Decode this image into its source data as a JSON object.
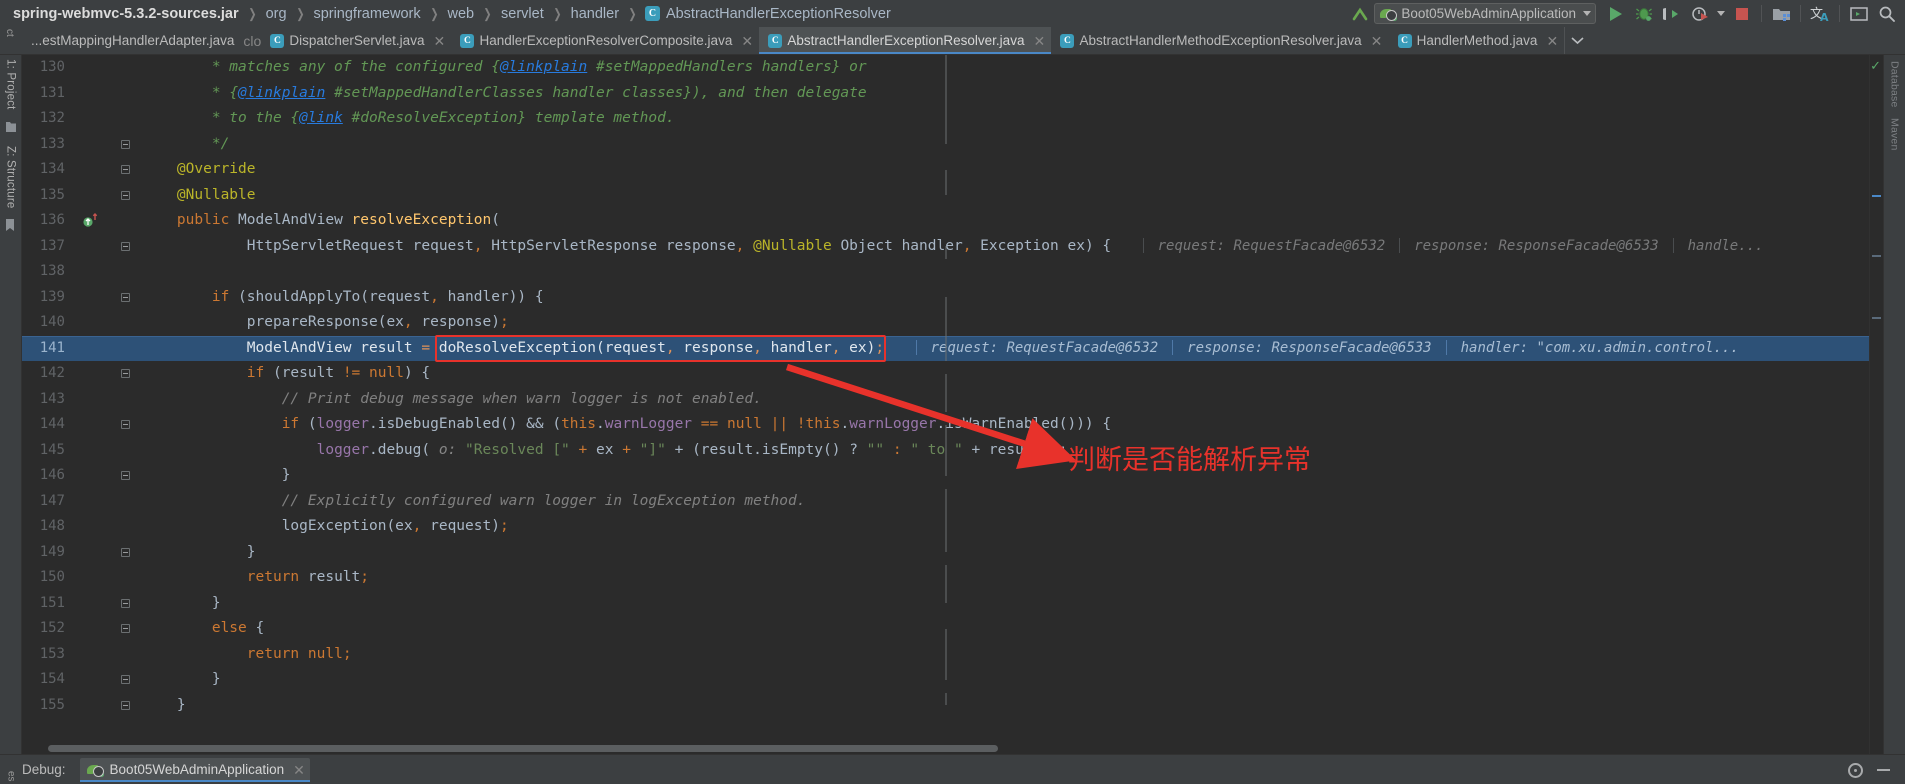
{
  "window": {
    "breadcrumb": {
      "root": "spring-webmvc-5.3.2-sources.jar",
      "items": [
        "org",
        "springframework",
        "web",
        "servlet",
        "handler"
      ],
      "class_badge": "C",
      "current_class": "AbstractHandlerExceptionResolver"
    },
    "toolbar": {
      "run_config": "Boot05WebAdminApplication",
      "icons": [
        "arrow-up-icon",
        "run-icon",
        "debug-icon",
        "run-coverage-icon",
        "profiler-icon",
        "stop-icon",
        "project-structure-icon",
        "translate-icon",
        "terminal-icon",
        "search-icon"
      ],
      "window_buttons": [
        "minimize",
        "maximize",
        "close"
      ]
    }
  },
  "tabs": {
    "items": [
      {
        "label": "...estMappingHandlerAdapter.java",
        "icon": "java-class-icon",
        "active": false,
        "truncated": true
      },
      {
        "label": "DispatcherServlet.java",
        "icon": "java-class-icon",
        "active": false
      },
      {
        "label": "HandlerExceptionResolverComposite.java",
        "icon": "java-class-icon",
        "active": false
      },
      {
        "label": "AbstractHandlerExceptionResolver.java",
        "icon": "java-class-icon",
        "active": true
      },
      {
        "label": "AbstractHandlerMethodExceptionResolver.java",
        "icon": "java-class-icon",
        "active": false
      },
      {
        "label": "HandlerMethod.java",
        "icon": "java-class-icon",
        "active": false
      }
    ],
    "overflow_icon": "chevron-down-icon",
    "close_icon": "close-icon"
  },
  "left_strip": {
    "items": [
      {
        "label": "1: Project",
        "name": "tool-window-project"
      },
      {
        "label": "Z: Structure",
        "name": "tool-window-structure"
      }
    ]
  },
  "right_strip": {
    "items": [
      {
        "label": "Database",
        "name": "tool-window-database"
      },
      {
        "label": "Maven",
        "name": "tool-window-maven"
      }
    ]
  },
  "editor": {
    "first_line": 130,
    "lines": [
      {
        "n": 130,
        "fold": "thru",
        "segments": [
          {
            "t": "        ",
            "c": "plain"
          },
          {
            "t": "* matches any of the configured ",
            "c": "cmt"
          },
          {
            "t": "{",
            "c": "cmt"
          },
          {
            "t": "@linkplain",
            "c": "doclink"
          },
          {
            "t": " #setMappedHandlers handlers} or",
            "c": "cmt"
          }
        ]
      },
      {
        "n": 131,
        "fold": "thru",
        "segments": [
          {
            "t": "        ",
            "c": "plain"
          },
          {
            "t": "* ",
            "c": "cmt"
          },
          {
            "t": "{",
            "c": "cmt"
          },
          {
            "t": "@linkplain",
            "c": "doclink"
          },
          {
            "t": " #setMappedHandlerClasses handler classes})",
            "c": "cmt"
          },
          {
            "t": ", and then delegate",
            "c": "cmt"
          }
        ]
      },
      {
        "n": 132,
        "fold": "thru",
        "segments": [
          {
            "t": "        ",
            "c": "plain"
          },
          {
            "t": "* to the ",
            "c": "cmt"
          },
          {
            "t": "{",
            "c": "cmt"
          },
          {
            "t": "@link",
            "c": "doclink"
          },
          {
            "t": " #doResolveException} template method.",
            "c": "cmt"
          }
        ]
      },
      {
        "n": 133,
        "fold": "end-up",
        "segments": [
          {
            "t": "        ",
            "c": "plain"
          },
          {
            "t": "*/",
            "c": "cmt"
          }
        ]
      },
      {
        "n": 134,
        "fold": "start",
        "segments": [
          {
            "t": "    ",
            "c": "plain"
          },
          {
            "t": "@Override",
            "c": "ann"
          }
        ]
      },
      {
        "n": 135,
        "fold": "end-up",
        "segments": [
          {
            "t": "    ",
            "c": "plain"
          },
          {
            "t": "@Nullable",
            "c": "ann"
          }
        ]
      },
      {
        "n": 136,
        "marker": "override-method-icon",
        "fold": "none",
        "segments": [
          {
            "t": "    ",
            "c": "plain"
          },
          {
            "t": "public",
            "c": "kw"
          },
          {
            "t": " ",
            "c": "plain"
          },
          {
            "t": "ModelAndView",
            "c": "typ"
          },
          {
            "t": " ",
            "c": "plain"
          },
          {
            "t": "resolveException",
            "c": "fn"
          },
          {
            "t": "(",
            "c": "punc"
          }
        ]
      },
      {
        "n": 137,
        "fold": "start",
        "segments": [
          {
            "t": "            ",
            "c": "plain"
          },
          {
            "t": "HttpServletRequest",
            "c": "typ"
          },
          {
            "t": " request",
            "c": "ident"
          },
          {
            "t": ",",
            "c": "semi"
          },
          {
            "t": " ",
            "c": "plain"
          },
          {
            "t": "HttpServletResponse",
            "c": "typ"
          },
          {
            "t": " response",
            "c": "ident"
          },
          {
            "t": ",",
            "c": "semi"
          },
          {
            "t": " ",
            "c": "plain"
          },
          {
            "t": "@Nullable",
            "c": "ann"
          },
          {
            "t": " ",
            "c": "plain"
          },
          {
            "t": "Object",
            "c": "typ"
          },
          {
            "t": " handler",
            "c": "ident"
          },
          {
            "t": ",",
            "c": "semi"
          },
          {
            "t": " ",
            "c": "plain"
          },
          {
            "t": "Exception",
            "c": "typ"
          },
          {
            "t": " ex",
            "c": "ident"
          },
          {
            "t": ")",
            "c": "punc"
          },
          {
            "t": " {",
            "c": "punc"
          }
        ],
        "debug": [
          "request: RequestFacade@6532",
          "response: ResponseFacade@6533",
          "handle..."
        ]
      },
      {
        "n": 138,
        "fold": "none",
        "segments": []
      },
      {
        "n": 139,
        "fold": "start",
        "segments": [
          {
            "t": "        ",
            "c": "plain"
          },
          {
            "t": "if",
            "c": "kw"
          },
          {
            "t": " (",
            "c": "punc"
          },
          {
            "t": "shouldApplyTo",
            "c": "ident"
          },
          {
            "t": "(request",
            "c": "ident"
          },
          {
            "t": ",",
            "c": "semi"
          },
          {
            "t": " handler",
            "c": "ident"
          },
          {
            "t": ")) {",
            "c": "punc"
          }
        ]
      },
      {
        "n": 140,
        "fold": "thru",
        "segments": [
          {
            "t": "            ",
            "c": "plain"
          },
          {
            "t": "prepareResponse",
            "c": "ident"
          },
          {
            "t": "(ex",
            "c": "ident"
          },
          {
            "t": ",",
            "c": "semi"
          },
          {
            "t": " response",
            "c": "ident"
          },
          {
            "t": ")",
            "c": "punc"
          },
          {
            "t": ";",
            "c": "semi"
          }
        ]
      },
      {
        "n": 141,
        "fold": "thru",
        "highlight": true,
        "boxed_call": "doResolveException(request, response, handler, ex);",
        "segments": [
          {
            "t": "            ",
            "c": "plain"
          },
          {
            "t": "ModelAndView",
            "c": "typ"
          },
          {
            "t": " result ",
            "c": "ident"
          },
          {
            "t": "=",
            "c": "semi"
          },
          {
            "t": " ",
            "c": "plain"
          },
          {
            "t": "doResolveException",
            "c": "ident"
          },
          {
            "t": "(request",
            "c": "ident"
          },
          {
            "t": ",",
            "c": "semi"
          },
          {
            "t": " response",
            "c": "ident"
          },
          {
            "t": ",",
            "c": "semi"
          },
          {
            "t": " handler",
            "c": "ident"
          },
          {
            "t": ",",
            "c": "semi"
          },
          {
            "t": " ex",
            "c": "ident"
          },
          {
            "t": ")",
            "c": "punc"
          },
          {
            "t": ";",
            "c": "semi"
          }
        ],
        "debug": [
          "request: RequestFacade@6532",
          "response: ResponseFacade@6533",
          "handler: \"com.xu.admin.control..."
        ]
      },
      {
        "n": 142,
        "fold": "start",
        "segments": [
          {
            "t": "            ",
            "c": "plain"
          },
          {
            "t": "if",
            "c": "kw"
          },
          {
            "t": " (result ",
            "c": "ident"
          },
          {
            "t": "!=",
            "c": "semi"
          },
          {
            "t": " ",
            "c": "plain"
          },
          {
            "t": "null",
            "c": "kw"
          },
          {
            "t": ") {",
            "c": "punc"
          }
        ]
      },
      {
        "n": 143,
        "fold": "thru",
        "segments": [
          {
            "t": "                ",
            "c": "plain"
          },
          {
            "t": "// Print debug message when warn logger is not enabled.",
            "c": "cmtln"
          }
        ]
      },
      {
        "n": 144,
        "fold": "start",
        "segments": [
          {
            "t": "                ",
            "c": "plain"
          },
          {
            "t": "if",
            "c": "kw"
          },
          {
            "t": " (",
            "c": "punc"
          },
          {
            "t": "logger",
            "c": "fld"
          },
          {
            "t": ".isDebugEnabled() && (",
            "c": "ident"
          },
          {
            "t": "this",
            "c": "kw"
          },
          {
            "t": ".",
            "c": "punc"
          },
          {
            "t": "warnLogger",
            "c": "fld"
          },
          {
            "t": " == ",
            "c": "semi"
          },
          {
            "t": "null",
            "c": "kw"
          },
          {
            "t": " || !",
            "c": "semi"
          },
          {
            "t": "this",
            "c": "kw"
          },
          {
            "t": ".",
            "c": "punc"
          },
          {
            "t": "warnLogger",
            "c": "fld"
          },
          {
            "t": ".isWarnEnabled())) {",
            "c": "ident"
          }
        ]
      },
      {
        "n": 145,
        "fold": "thru",
        "segments": [
          {
            "t": "                    ",
            "c": "plain"
          },
          {
            "t": "logger",
            "c": "fld"
          },
          {
            "t": ".debug(",
            "c": "ident"
          },
          {
            "t": " o: ",
            "c": "param-hint"
          },
          {
            "t": "\"Resolved [\"",
            "c": "str"
          },
          {
            "t": " + ",
            "c": "semi"
          },
          {
            "t": "ex",
            "c": "ident"
          },
          {
            "t": " + ",
            "c": "semi"
          },
          {
            "t": "\"]\"",
            "c": "str"
          },
          {
            "t": " + (result.isEmpty() ? ",
            "c": "ident"
          },
          {
            "t": "\"\"",
            "c": "str"
          },
          {
            "t": " : ",
            "c": "semi"
          },
          {
            "t": "\" to \"",
            "c": "str"
          },
          {
            "t": " + result));",
            "c": "ident"
          }
        ]
      },
      {
        "n": 146,
        "fold": "end-up",
        "segments": [
          {
            "t": "                ",
            "c": "plain"
          },
          {
            "t": "}",
            "c": "punc"
          }
        ]
      },
      {
        "n": 147,
        "fold": "thru",
        "segments": [
          {
            "t": "                ",
            "c": "plain"
          },
          {
            "t": "// Explicitly configured warn logger in logException method.",
            "c": "cmtln"
          }
        ]
      },
      {
        "n": 148,
        "fold": "thru",
        "segments": [
          {
            "t": "                ",
            "c": "plain"
          },
          {
            "t": "logException",
            "c": "ident"
          },
          {
            "t": "(ex",
            "c": "ident"
          },
          {
            "t": ",",
            "c": "semi"
          },
          {
            "t": " request",
            "c": "ident"
          },
          {
            "t": ")",
            "c": "punc"
          },
          {
            "t": ";",
            "c": "semi"
          }
        ]
      },
      {
        "n": 149,
        "fold": "end-up",
        "segments": [
          {
            "t": "            ",
            "c": "plain"
          },
          {
            "t": "}",
            "c": "punc"
          }
        ]
      },
      {
        "n": 150,
        "fold": "thru",
        "segments": [
          {
            "t": "            ",
            "c": "plain"
          },
          {
            "t": "return",
            "c": "kw"
          },
          {
            "t": " result",
            "c": "ident"
          },
          {
            "t": ";",
            "c": "semi"
          }
        ]
      },
      {
        "n": 151,
        "fold": "end-up",
        "segments": [
          {
            "t": "        ",
            "c": "plain"
          },
          {
            "t": "}",
            "c": "punc"
          }
        ]
      },
      {
        "n": 152,
        "fold": "start",
        "segments": [
          {
            "t": "        ",
            "c": "plain"
          },
          {
            "t": "else",
            "c": "kw"
          },
          {
            "t": " {",
            "c": "punc"
          }
        ]
      },
      {
        "n": 153,
        "fold": "thru",
        "segments": [
          {
            "t": "            ",
            "c": "plain"
          },
          {
            "t": "return",
            "c": "kw"
          },
          {
            "t": " ",
            "c": "plain"
          },
          {
            "t": "null",
            "c": "kw"
          },
          {
            "t": ";",
            "c": "semi"
          }
        ]
      },
      {
        "n": 154,
        "fold": "end-up",
        "segments": [
          {
            "t": "        ",
            "c": "plain"
          },
          {
            "t": "}",
            "c": "punc"
          }
        ]
      },
      {
        "n": 155,
        "fold": "end-up",
        "segments": [
          {
            "t": "    ",
            "c": "plain"
          },
          {
            "t": "}",
            "c": "punc"
          }
        ]
      }
    ]
  },
  "annotation": {
    "text": "判断是否能解析异常",
    "color": "#e8322b",
    "arrow": "red-arrow"
  },
  "bottom": {
    "debug_label": "Debug:",
    "session_tab": "Boot05WebAdminApplication",
    "session_icon": "spring-boot-icon",
    "close_icon": "close-icon",
    "settings_icon": "gear-icon",
    "hide_icon": "minimize-icon"
  },
  "colors": {
    "editor_bg": "#2b2b2b",
    "chrome_bg": "#3c3f41",
    "highlight_row": "#2d5177",
    "accent": "#4a88c7",
    "annotation_red": "#e8322b",
    "comment_green": "#629755",
    "keyword_orange": "#cc7832",
    "string_green": "#6a8759"
  }
}
